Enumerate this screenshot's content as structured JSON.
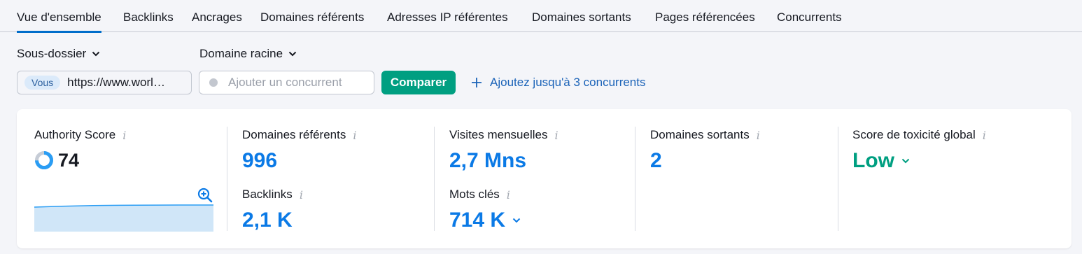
{
  "tabs": [
    {
      "label": "Vue d'ensemble",
      "active": true
    },
    {
      "label": "Backlinks"
    },
    {
      "label": "Ancrages"
    },
    {
      "label": "Domaines référents"
    },
    {
      "label": "Adresses IP référentes"
    },
    {
      "label": "Domaines sortants"
    },
    {
      "label": "Pages référencées"
    },
    {
      "label": "Concurrents"
    }
  ],
  "filters": {
    "scope_label": "Sous-dossier",
    "domain_label": "Domaine racine"
  },
  "compare": {
    "you_badge": "Vous",
    "your_url": "https://www.worl…",
    "competitor_placeholder": "Ajouter un concurrent",
    "compare_button": "Comparer",
    "add_link": "Ajoutez jusqu'à 3 concurrents"
  },
  "metrics": {
    "authority": {
      "label": "Authority Score",
      "value": "74",
      "score_fraction": 0.74
    },
    "referring_domains": {
      "label": "Domaines référents",
      "value": "996"
    },
    "backlinks": {
      "label": "Backlinks",
      "value": "2,1 K"
    },
    "monthly_visits": {
      "label": "Visites mensuelles",
      "value": "2,7 Mns"
    },
    "keywords": {
      "label": "Mots clés",
      "value": "714 K"
    },
    "outbound_domains": {
      "label": "Domaines sortants",
      "value": "2"
    },
    "toxicity": {
      "label": "Score de toxicité global",
      "value": "Low"
    }
  },
  "colors": {
    "accent": "#006dca",
    "value_blue": "#0b7ae6",
    "compare_green": "#009f81",
    "link_blue": "#1b63b8"
  },
  "icons": {
    "info": "info-icon",
    "chevron": "chevron-down-icon",
    "zoom": "zoom-in-icon",
    "plus": "plus-icon"
  }
}
